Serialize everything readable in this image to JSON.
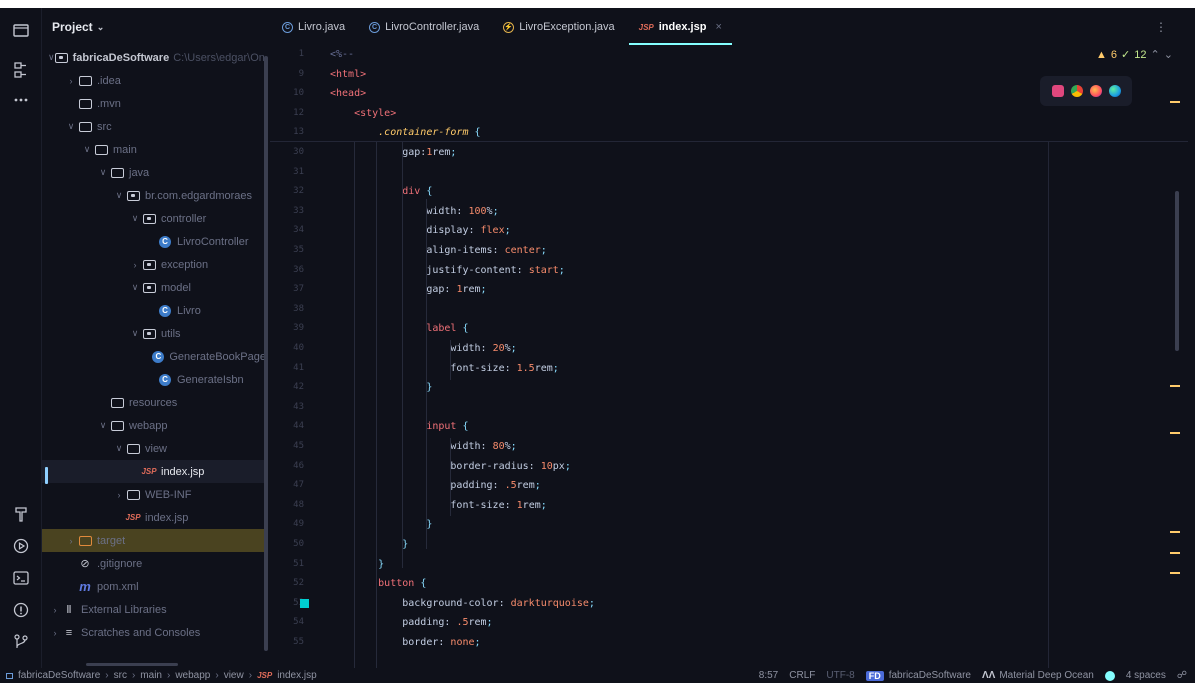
{
  "project_panel": {
    "title": "Project",
    "tree": [
      {
        "label": "fabricaDeSoftware",
        "suffix": "C:\\Users\\edgar\\One",
        "indent": 0,
        "chevron": "v",
        "icon": "module-folder-icon",
        "bold": true
      },
      {
        "label": ".idea",
        "indent": 1,
        "chevron": ">",
        "icon": "folder-icon"
      },
      {
        "label": ".mvn",
        "indent": 1,
        "chevron": "",
        "icon": "folder-icon"
      },
      {
        "label": "src",
        "indent": 1,
        "chevron": "v",
        "icon": "folder-icon"
      },
      {
        "label": "main",
        "indent": 2,
        "chevron": "v",
        "icon": "folder-icon"
      },
      {
        "label": "java",
        "indent": 3,
        "chevron": "v",
        "icon": "source-folder-icon"
      },
      {
        "label": "br.com.edgardmoraes",
        "indent": 4,
        "chevron": "v",
        "icon": "package-icon"
      },
      {
        "label": "controller",
        "indent": 5,
        "chevron": "v",
        "icon": "package-icon"
      },
      {
        "label": "LivroController",
        "indent": 6,
        "chevron": "",
        "icon": "class-icon"
      },
      {
        "label": "exception",
        "indent": 5,
        "chevron": ">",
        "icon": "package-icon"
      },
      {
        "label": "model",
        "indent": 5,
        "chevron": "v",
        "icon": "package-icon"
      },
      {
        "label": "Livro",
        "indent": 6,
        "chevron": "",
        "icon": "class-icon"
      },
      {
        "label": "utils",
        "indent": 5,
        "chevron": "v",
        "icon": "package-icon"
      },
      {
        "label": "GenerateBookPage",
        "indent": 6,
        "chevron": "",
        "icon": "class-icon"
      },
      {
        "label": "GenerateIsbn",
        "indent": 6,
        "chevron": "",
        "icon": "class-icon"
      },
      {
        "label": "resources",
        "indent": 3,
        "chevron": "",
        "icon": "resources-folder-icon"
      },
      {
        "label": "webapp",
        "indent": 3,
        "chevron": "v",
        "icon": "folder-icon"
      },
      {
        "label": "view",
        "indent": 4,
        "chevron": "v",
        "icon": "folder-icon"
      },
      {
        "label": "index.jsp",
        "indent": 5,
        "chevron": "",
        "icon": "jsp-file-icon",
        "selected": true
      },
      {
        "label": "WEB-INF",
        "indent": 4,
        "chevron": ">",
        "icon": "folder-icon"
      },
      {
        "label": "index.jsp",
        "indent": 4,
        "chevron": "",
        "icon": "jsp-file-icon"
      },
      {
        "label": "target",
        "indent": 1,
        "chevron": ">",
        "icon": "excluded-folder-icon",
        "highlight": true
      },
      {
        "label": ".gitignore",
        "indent": 1,
        "chevron": "",
        "icon": "ignore-file-icon"
      },
      {
        "label": "pom.xml",
        "indent": 1,
        "chevron": "",
        "icon": "maven-icon"
      },
      {
        "label": "External Libraries",
        "indent": 0,
        "chevron": ">",
        "icon": "libraries-icon"
      },
      {
        "label": "Scratches and Consoles",
        "indent": 0,
        "chevron": ">",
        "icon": "scratches-icon"
      }
    ]
  },
  "tabs": [
    {
      "label": "Livro.java",
      "icon": "class-icon"
    },
    {
      "label": "LivroController.java",
      "icon": "class-icon"
    },
    {
      "label": "LivroException.java",
      "icon": "exception-class-icon"
    },
    {
      "label": "index.jsp",
      "icon": "jsp-file-icon",
      "active": true,
      "close": "×"
    }
  ],
  "editor": {
    "inspections": {
      "warnings": "6",
      "weak_warnings": "12"
    },
    "sticky_lines": [
      {
        "ln": "1",
        "parts": [
          [
            "cmt",
            "<%--"
          ]
        ]
      },
      {
        "ln": "9",
        "parts": [
          [
            "tag",
            "<html>"
          ]
        ]
      },
      {
        "ln": "10",
        "parts": [
          [
            "tag",
            "<head>"
          ]
        ]
      },
      {
        "ln": "12",
        "parts": [
          [
            "tag",
            "    <style>"
          ]
        ]
      },
      {
        "ln": "13",
        "parts": [
          [
            "sel",
            "        .container-form "
          ],
          [
            "punc",
            "{"
          ]
        ]
      }
    ],
    "lines": [
      {
        "ln": "30",
        "parts": [
          [
            "prop",
            "            gap:"
          ],
          [
            "num",
            "1"
          ],
          [
            "unit",
            "rem"
          ],
          [
            "punc",
            ";"
          ]
        ]
      },
      {
        "ln": "31",
        "parts": []
      },
      {
        "ln": "32",
        "parts": [
          [
            "kw",
            "            div "
          ],
          [
            "punc",
            "{"
          ]
        ]
      },
      {
        "ln": "33",
        "parts": [
          [
            "prop",
            "                width: "
          ],
          [
            "num",
            "100"
          ],
          [
            "unit",
            "%"
          ],
          [
            "punc",
            ";"
          ]
        ]
      },
      {
        "ln": "34",
        "parts": [
          [
            "prop",
            "                display: "
          ],
          [
            "val",
            "flex"
          ],
          [
            "punc",
            ";"
          ]
        ]
      },
      {
        "ln": "35",
        "parts": [
          [
            "prop",
            "                align-items: "
          ],
          [
            "val",
            "center"
          ],
          [
            "punc",
            ";"
          ]
        ]
      },
      {
        "ln": "36",
        "parts": [
          [
            "prop",
            "                justify-content: "
          ],
          [
            "val",
            "start"
          ],
          [
            "punc",
            ";"
          ]
        ]
      },
      {
        "ln": "37",
        "parts": [
          [
            "prop",
            "                gap: "
          ],
          [
            "num",
            "1"
          ],
          [
            "unit",
            "rem"
          ],
          [
            "punc",
            ";"
          ]
        ]
      },
      {
        "ln": "38",
        "parts": []
      },
      {
        "ln": "39",
        "parts": [
          [
            "kw",
            "                label "
          ],
          [
            "punc",
            "{"
          ]
        ]
      },
      {
        "ln": "40",
        "parts": [
          [
            "prop",
            "                    width: "
          ],
          [
            "num",
            "20"
          ],
          [
            "unit",
            "%"
          ],
          [
            "punc",
            ";"
          ]
        ]
      },
      {
        "ln": "41",
        "parts": [
          [
            "prop",
            "                    font-size: "
          ],
          [
            "num",
            "1.5"
          ],
          [
            "unit",
            "rem"
          ],
          [
            "punc",
            ";"
          ]
        ]
      },
      {
        "ln": "42",
        "parts": [
          [
            "punc",
            "                }"
          ]
        ]
      },
      {
        "ln": "43",
        "parts": []
      },
      {
        "ln": "44",
        "parts": [
          [
            "kw",
            "                input "
          ],
          [
            "punc",
            "{"
          ]
        ]
      },
      {
        "ln": "45",
        "parts": [
          [
            "prop",
            "                    width: "
          ],
          [
            "num",
            "80"
          ],
          [
            "unit",
            "%"
          ],
          [
            "punc",
            ";"
          ]
        ]
      },
      {
        "ln": "46",
        "parts": [
          [
            "prop",
            "                    border-radius: "
          ],
          [
            "num",
            "10"
          ],
          [
            "unit",
            "px"
          ],
          [
            "punc",
            ";"
          ]
        ]
      },
      {
        "ln": "47",
        "parts": [
          [
            "prop",
            "                    padding: "
          ],
          [
            "num",
            ".5"
          ],
          [
            "unit",
            "rem"
          ],
          [
            "punc",
            ";"
          ]
        ]
      },
      {
        "ln": "48",
        "parts": [
          [
            "prop",
            "                    font-size: "
          ],
          [
            "num",
            "1"
          ],
          [
            "unit",
            "rem"
          ],
          [
            "punc",
            ";"
          ]
        ]
      },
      {
        "ln": "49",
        "parts": [
          [
            "punc",
            "                }"
          ]
        ]
      },
      {
        "ln": "50",
        "parts": [
          [
            "punc",
            "            }"
          ]
        ]
      },
      {
        "ln": "51",
        "parts": [
          [
            "punc",
            "        }"
          ]
        ]
      },
      {
        "ln": "52",
        "parts": [
          [
            "kw",
            "        button "
          ],
          [
            "punc",
            "{"
          ]
        ]
      },
      {
        "ln": "53",
        "parts": [
          [
            "prop",
            "            background-color: "
          ],
          [
            "val",
            "darkturquoise"
          ],
          [
            "punc",
            ";"
          ]
        ]
      },
      {
        "ln": "54",
        "parts": [
          [
            "prop",
            "            padding: "
          ],
          [
            "num",
            ".5"
          ],
          [
            "unit",
            "rem"
          ],
          [
            "punc",
            ";"
          ]
        ]
      },
      {
        "ln": "55",
        "parts": [
          [
            "prop",
            "            border: "
          ],
          [
            "val",
            "none"
          ],
          [
            "punc",
            ";"
          ]
        ]
      }
    ]
  },
  "status_bar": {
    "breadcrumbs": [
      "fabricaDeSoftware",
      "src",
      "main",
      "webapp",
      "view",
      "index.jsp"
    ],
    "position": "8:57",
    "line_separator": "CRLF",
    "encoding": "UTF-8",
    "project_badge": "FD",
    "project_name": "fabricaDeSoftware",
    "theme": "Material Deep Ocean",
    "indent": "4 spaces"
  },
  "colors": {
    "background": "#0f111a",
    "accent": "#84ffff",
    "swatch_darkturquoise": "#00ced1",
    "target_highlight": "#4a4320"
  }
}
